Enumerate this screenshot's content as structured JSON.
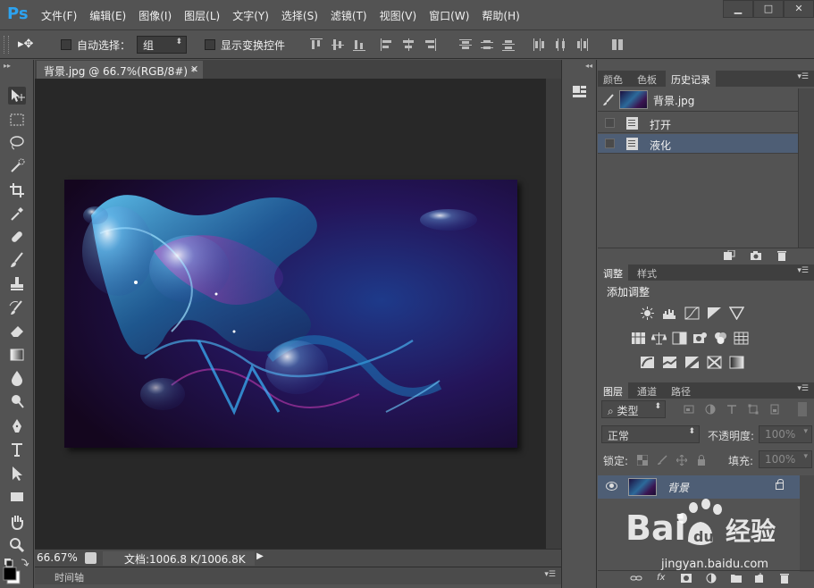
{
  "app": {
    "logo": "Ps",
    "menu": [
      "文件(F)",
      "编辑(E)",
      "图像(I)",
      "图层(L)",
      "文字(Y)",
      "选择(S)",
      "滤镜(T)",
      "视图(V)",
      "窗口(W)",
      "帮助(H)"
    ],
    "window_controls": {
      "minimize": "▁",
      "restore": "□",
      "close": "✕"
    }
  },
  "options_bar": {
    "auto_select_label": "自动选择：",
    "auto_select_checked": false,
    "auto_select_value": "组",
    "show_transform_label": "显示变换控件",
    "show_transform_checked": false
  },
  "document": {
    "tab_title": "背景.jpg @ 66.7%(RGB/8#) *",
    "zoom": "66.67%",
    "doc_info": "文档:1006.8 K/1006.8K",
    "timeline_label": "时间轴"
  },
  "history_panel": {
    "tabs": [
      "颜色",
      "色板",
      "历史记录"
    ],
    "active_tab": "历史记录",
    "snapshot_name": "背景.jpg",
    "states": [
      {
        "label": "打开",
        "selected": false
      },
      {
        "label": "液化",
        "selected": true
      }
    ]
  },
  "adjustments_panel": {
    "tabs": [
      "调整",
      "样式"
    ],
    "active_tab": "调整",
    "title": "添加调整"
  },
  "layers_panel": {
    "tabs": [
      "图层",
      "通道",
      "路径"
    ],
    "active_tab": "图层",
    "filter_kind": "类型",
    "blend_mode": "正常",
    "opacity_label": "不透明度:",
    "opacity_value": "100%",
    "lock_label": "锁定:",
    "fill_label": "填充:",
    "fill_value": "100%",
    "layers": [
      {
        "name": "背景",
        "visible": true,
        "locked": true
      }
    ]
  },
  "watermark": {
    "text": "jingyan.baidu.com"
  },
  "colors": {
    "ui_bg": "#535353",
    "canvas_bg": "#282828",
    "selection": "#4e5e75",
    "ps_blue": "#2da3f0"
  }
}
